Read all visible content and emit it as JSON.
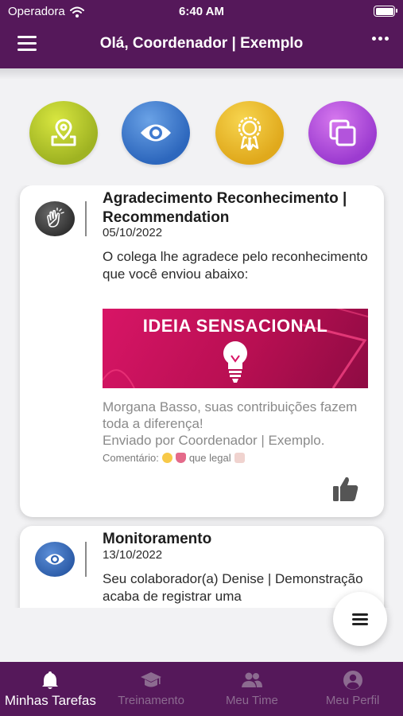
{
  "status_bar": {
    "carrier": "Operadora",
    "time": "6:40 AM"
  },
  "header": {
    "title": "Olá, Coordenador | Exemplo"
  },
  "quick_actions": [
    {
      "icon": "location-pin-icon",
      "color": "#b5c92b"
    },
    {
      "icon": "eye-icon",
      "color": "#3f7ad0"
    },
    {
      "icon": "award-badge-icon",
      "color": "#eab92e"
    },
    {
      "icon": "copy-icon",
      "color": "#b354dc"
    }
  ],
  "cards": [
    {
      "icon": "clapping-hands-icon",
      "title": "Agradecimento Reconhecimento | Recommendation",
      "date": "05/10/2022",
      "body": "O colega lhe agradece pelo reconhecimento que você enviou abaixo:",
      "banner_text": "IDEIA SENSACIONAL",
      "subtext_line1": "Morgana Basso, suas contribuições fazem toda a diferença!",
      "subtext_line2": "Enviado por Coordenador | Exemplo.",
      "comment_label": "Comentário:",
      "comment_text": "que legal"
    },
    {
      "icon": "eye-icon",
      "title": "Monitoramento",
      "date": "13/10/2022",
      "body": "Seu colaborador(a) Denise | Demonstração acaba de registrar uma"
    }
  ],
  "tabs": [
    {
      "label": "Minhas Tarefas",
      "icon": "bell-icon",
      "active": true
    },
    {
      "label": "Treinamento",
      "icon": "graduation-cap-icon",
      "active": false
    },
    {
      "label": "Meu Time",
      "icon": "group-icon",
      "active": false
    },
    {
      "label": "Meu Perfil",
      "icon": "profile-icon",
      "active": false
    }
  ],
  "colors": {
    "brand": "#55185a",
    "tab_inactive": "#8c6b90"
  }
}
